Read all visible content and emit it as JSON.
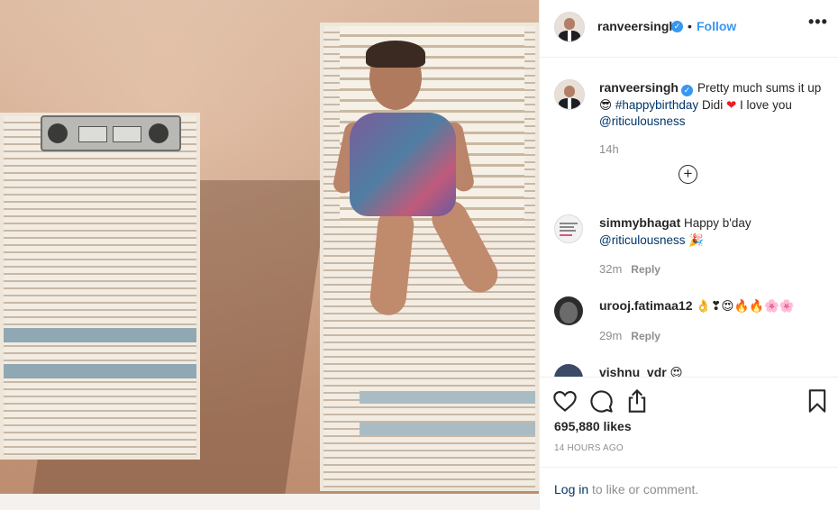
{
  "post": {
    "username": "ranveersingh",
    "follow_label": "Follow",
    "dot": "•",
    "more_label": "•••",
    "verified_glyph": "✓"
  },
  "caption": {
    "username": "ranveersingh",
    "text_1": "Pretty much sums it up",
    "emoji_sunglasses": "😎",
    "hashtag": "#happybirthday",
    "text_2": "Didi",
    "emoji_heart": "❤",
    "text_3": "I love you",
    "mention": "@riticulousness",
    "time": "14h",
    "load_more": "+"
  },
  "comments": [
    {
      "username": "simmybhagat",
      "text": "Happy b'day",
      "mention": "@riticulousness",
      "emoji": "🎉",
      "time": "32m",
      "reply_label": "Reply"
    },
    {
      "username": "urooj.fatimaa12",
      "emoji": "👌❣😍🔥🔥🌸🌸",
      "time": "29m",
      "reply_label": "Reply"
    },
    {
      "username": "vishnu_vdr",
      "emoji": "😍"
    }
  ],
  "actions": {
    "likes": "695,880 likes",
    "time_ago": "14 HOURS AGO"
  },
  "footer": {
    "login_link": "Log in",
    "login_rest": "to like or comment."
  },
  "colors": {
    "accent": "#3897f0",
    "link": "#003569",
    "muted": "#8e8e8e",
    "text": "#262626",
    "heart": "#ed1c24"
  }
}
